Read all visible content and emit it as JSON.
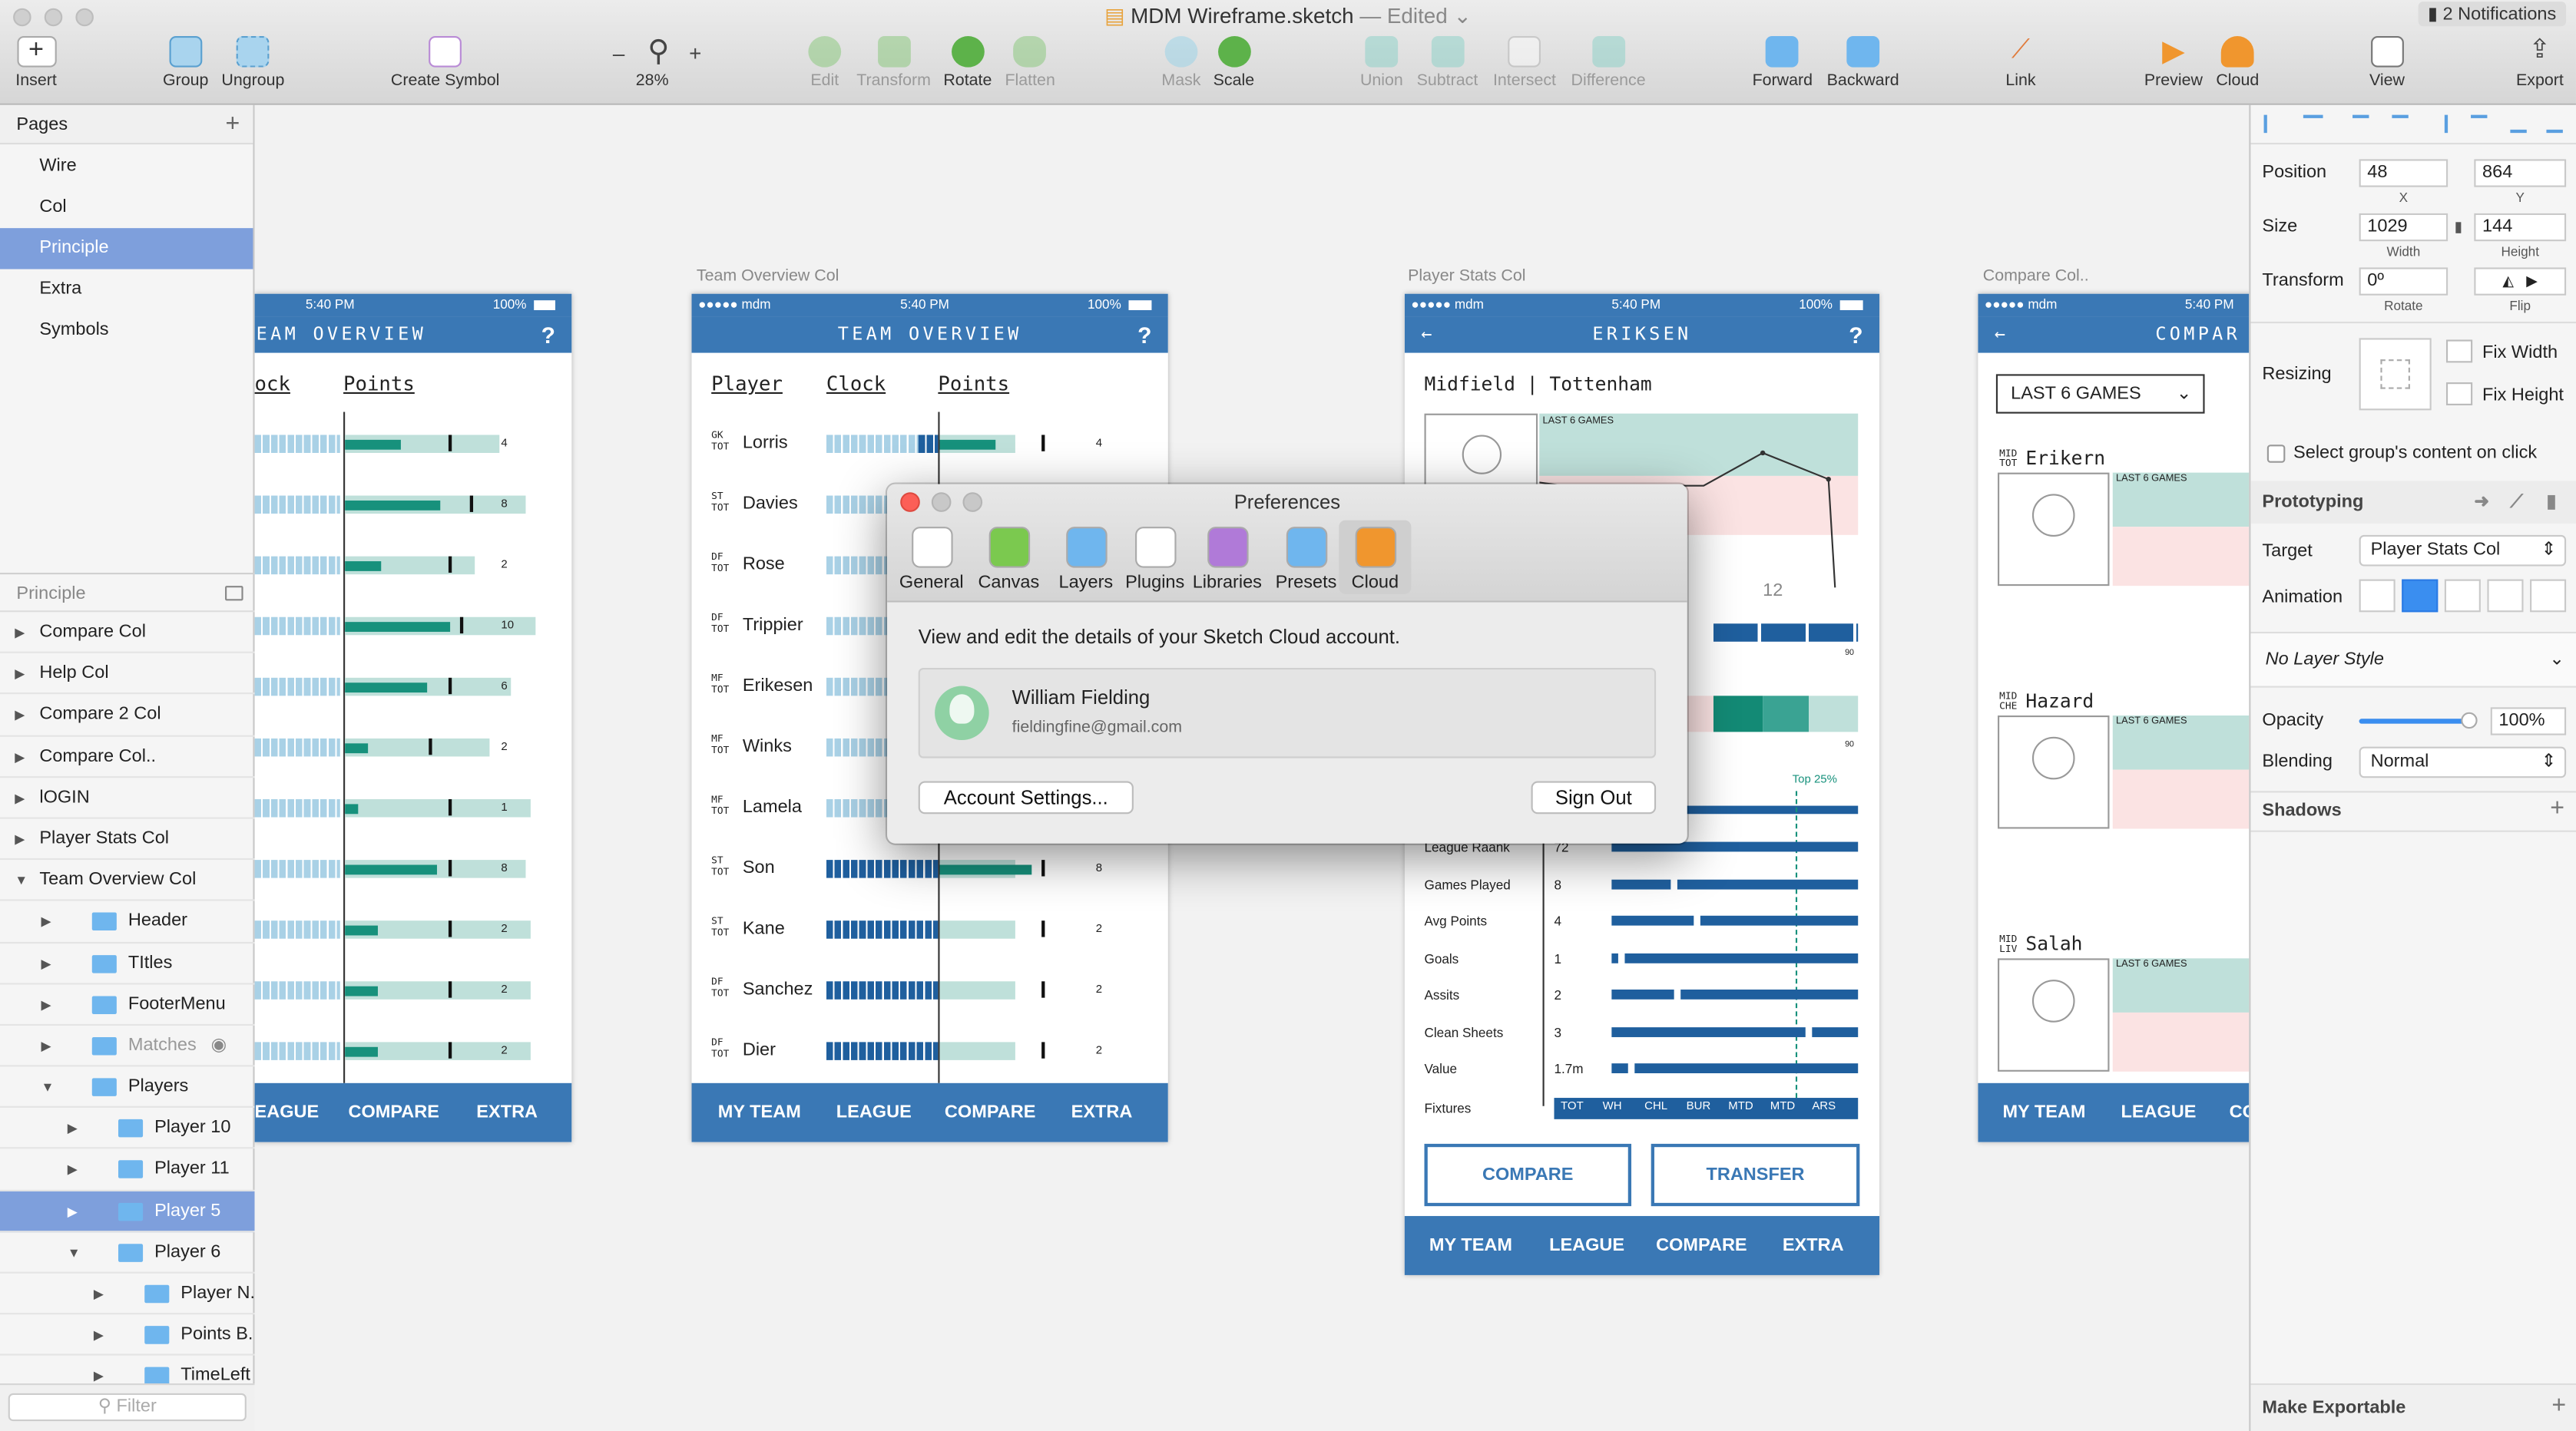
{
  "window": {
    "title": "MDM Wireframe.sketch",
    "edited": "— Edited",
    "notifications": "2 Notifications"
  },
  "toolbar": {
    "insert": "Insert",
    "group": "Group",
    "ungroup": "Ungroup",
    "create_symbol": "Create Symbol",
    "zoom_minus": "–",
    "zoom_plus": "+",
    "zoom": "28%",
    "edit": "Edit",
    "transform": "Transform",
    "rotate": "Rotate",
    "flatten": "Flatten",
    "mask": "Mask",
    "scale": "Scale",
    "union": "Union",
    "subtract": "Subtract",
    "intersect": "Intersect",
    "difference": "Difference",
    "forward": "Forward",
    "backward": "Backward",
    "link": "Link",
    "preview": "Preview",
    "cloud": "Cloud",
    "view": "View",
    "export": "Export"
  },
  "pages": {
    "header": "Pages",
    "add": "+",
    "items": [
      "Wire",
      "Col",
      "Principle",
      "Extra",
      "Symbols"
    ],
    "selected": "Principle"
  },
  "layers": {
    "header": "Principle",
    "filter_placeholder": "Filter",
    "items": [
      {
        "label": "Compare Col",
        "level": 0,
        "open": false
      },
      {
        "label": "Help Col",
        "level": 0,
        "open": false
      },
      {
        "label": "Compare 2 Col",
        "level": 0,
        "open": false
      },
      {
        "label": "Compare Col..",
        "level": 0,
        "open": false
      },
      {
        "label": "lOGIN",
        "level": 0,
        "open": false
      },
      {
        "label": "Player Stats Col",
        "level": 0,
        "open": false
      },
      {
        "label": "Team Overview Col",
        "level": 0,
        "open": true
      },
      {
        "label": "Header",
        "level": 1,
        "folder": true
      },
      {
        "label": "TItles",
        "level": 1,
        "folder": true
      },
      {
        "label": "FooterMenu",
        "level": 1,
        "folder": true
      },
      {
        "label": "Matches",
        "level": 1,
        "folder": true,
        "hidden": true
      },
      {
        "label": "Players",
        "level": 1,
        "folder": true,
        "open": true
      },
      {
        "label": "Player 10",
        "level": 2,
        "folder": true
      },
      {
        "label": "Player 11",
        "level": 2,
        "folder": true
      },
      {
        "label": "Player 5",
        "level": 2,
        "folder": true,
        "selected": true
      },
      {
        "label": "Player 6",
        "level": 2,
        "folder": true,
        "open": true
      },
      {
        "label": "Player N...",
        "level": 3,
        "folder": true
      },
      {
        "label": "Points B...",
        "level": 3,
        "folder": true
      },
      {
        "label": "TimeLeft",
        "level": 3,
        "folder": true
      }
    ]
  },
  "artboards": {
    "partial": {
      "status_time": "5:40 PM",
      "battery": "100%",
      "title": "EAM OVERVIEW",
      "help": "?",
      "col_clock": "ock",
      "col_points": "Points",
      "points": [
        "4",
        "8",
        "2",
        "10",
        "6",
        "2",
        "1",
        "8",
        "2",
        "2",
        "2"
      ],
      "footer": [
        "EAGUE",
        "COMPARE",
        "EXTRA"
      ]
    },
    "team": {
      "label": "Team Overview Col",
      "carrier": "●●●●● mdm",
      "status_time": "5:40 PM",
      "battery": "100%",
      "title": "TEAM OVERVIEW",
      "help": "?",
      "col_player": "Player",
      "col_clock": "Clock",
      "col_points": "Points",
      "players": [
        {
          "pos": "GK",
          "club": "TOT",
          "name": "Lorris",
          "pts": "4"
        },
        {
          "pos": "ST",
          "club": "TOT",
          "name": "Davies",
          "pts": ""
        },
        {
          "pos": "DF",
          "club": "TOT",
          "name": "Rose",
          "pts": ""
        },
        {
          "pos": "DF",
          "club": "TOT",
          "name": "Trippier",
          "pts": ""
        },
        {
          "pos": "MF",
          "club": "TOT",
          "name": "Erikesen",
          "pts": ""
        },
        {
          "pos": "MF",
          "club": "TOT",
          "name": "Winks",
          "pts": ""
        },
        {
          "pos": "MF",
          "club": "TOT",
          "name": "Lamela",
          "pts": ""
        },
        {
          "pos": "ST",
          "club": "TOT",
          "name": "Son",
          "pts": "8"
        },
        {
          "pos": "ST",
          "club": "TOT",
          "name": "Kane",
          "pts": "2"
        },
        {
          "pos": "DF",
          "club": "TOT",
          "name": "Sanchez",
          "pts": "2"
        },
        {
          "pos": "DF",
          "club": "TOT",
          "name": "Dier",
          "pts": "2"
        }
      ],
      "footer": [
        "MY TEAM",
        "LEAGUE",
        "COMPARE",
        "EXTRA"
      ]
    },
    "stats": {
      "label": "Player Stats Col",
      "carrier": "●●●●● mdm",
      "status_time": "5:40 PM",
      "battery": "100%",
      "back": "←",
      "title": "ERIKSEN",
      "help": "?",
      "subtitle": "Midfield | Tottenham",
      "games_label": "LAST 6 GAMES",
      "value_12": "12",
      "n90a": "90",
      "n90b": "90",
      "top_label": "Top 25%",
      "rows": [
        {
          "label": "League Raank",
          "value": "72"
        },
        {
          "label": "Games Played",
          "value": "8"
        },
        {
          "label": "Avg Points",
          "value": "4"
        },
        {
          "label": "Goals",
          "value": "1"
        },
        {
          "label": "Assits",
          "value": "2"
        },
        {
          "label": "Clean Sheets",
          "value": "3"
        },
        {
          "label": "Value",
          "value": "1.7m"
        }
      ],
      "fixtures_label": "Fixtures",
      "fixtures": [
        "TOT",
        "WH",
        "CHL",
        "BUR",
        "MTD",
        "MTD",
        "ARS"
      ],
      "compare": "COMPARE",
      "transfer": "TRANSFER",
      "footer": [
        "MY TEAM",
        "LEAGUE",
        "COMPARE",
        "EXTRA"
      ]
    },
    "compare": {
      "label": "Compare Col..",
      "carrier": "●●●●● mdm",
      "status_time": "5:40 PM",
      "back": "←",
      "title": "COMPAR",
      "dropdown": "LAST 6 GAMES",
      "players": [
        {
          "pos": "MID",
          "club": "TOT",
          "name": "Erikern",
          "games": "LAST 6 GAMES"
        },
        {
          "pos": "MID",
          "club": "CHE",
          "name": "Hazard",
          "games": "LAST 6 GAMES"
        },
        {
          "pos": "MID",
          "club": "LIV",
          "name": "Salah",
          "games": "LAST 6 GAMES"
        }
      ],
      "footer": [
        "MY TEAM",
        "LEAGUE",
        "CO"
      ]
    }
  },
  "inspector": {
    "position": "Position",
    "x": "48",
    "y": "864",
    "x_label": "X",
    "y_label": "Y",
    "size": "Size",
    "width": "1029",
    "height": "144",
    "width_label": "Width",
    "height_label": "Height",
    "transform": "Transform",
    "rotate_value": "0º",
    "rotate_label": "Rotate",
    "flip_label": "Flip",
    "resizing": "Resizing",
    "fix_width": "Fix Width",
    "fix_height": "Fix Height",
    "select_group": "Select group's content on click",
    "prototyping": "Prototyping",
    "target": "Target",
    "target_value": "Player Stats Col",
    "animation": "Animation",
    "layer_style": "No Layer Style",
    "opacity": "Opacity",
    "opacity_value": "100%",
    "opacity_level": 0.95,
    "blending": "Blending",
    "blending_value": "Normal",
    "shadows": "Shadows",
    "make_exportable": "Make Exportable"
  },
  "preferences": {
    "title": "Preferences",
    "tabs": [
      "General",
      "Canvas",
      "Layers",
      "Plugins",
      "Libraries",
      "Presets",
      "Cloud"
    ],
    "selected": "Cloud",
    "description": "View and edit the details of your Sketch Cloud account.",
    "user_name": "William Fielding",
    "user_email": "fieldingfine@gmail.com",
    "account_settings": "Account Settings...",
    "sign_out": "Sign Out"
  },
  "colors": {
    "brand": "#3a78b5",
    "accent_green": "#17917c",
    "selection": "#7e9fdc"
  }
}
